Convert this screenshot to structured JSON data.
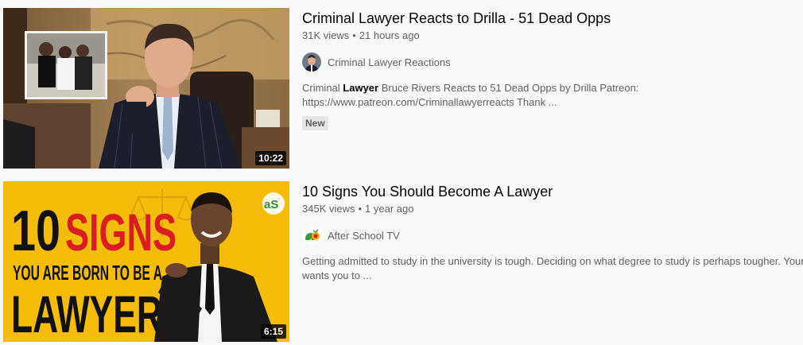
{
  "videos": [
    {
      "title": "Criminal Lawyer Reacts to Drilla - 51 Dead Opps",
      "views": "31K views",
      "age": "21 hours ago",
      "channel": "Criminal Lawyer Reactions",
      "desc_line1_pre": "Criminal ",
      "desc_line1_highlight": "Lawyer",
      "desc_line1_post": " Bruce Rivers Reacts to 51 Dead Opps by Drilla Patreon:",
      "desc_line2": "https://www.patreon.com/Criminallawyerreacts Thank ...",
      "badge": "New",
      "duration": "10:22",
      "thumbnail_icon": "lawyer-at-desk-thumbnail",
      "avatar_icon": "lawyer-avatar-icon"
    },
    {
      "title": "10 Signs You Should Become A Lawyer",
      "views": "345K views",
      "age": "1 year ago",
      "channel": "After School TV",
      "desc_line1": "Getting admitted to study in the university is tough. Deciding on what degree to study is perhaps tougher. Your",
      "desc_line2": "wants you to ...",
      "duration": "6:15",
      "thumb_number": "10",
      "thumb_signs": "SIGNS",
      "thumb_subtitle": "YOU ARE BORN TO BE A",
      "thumb_word": "LAWYER",
      "thumb_logo": "aS",
      "thumbnail_icon": "ten-signs-lawyer-thumbnail",
      "avatar_icon": "after-school-tv-logo-icon"
    }
  ],
  "colors": {
    "background": "#f9f9f9",
    "title_text": "#030303",
    "meta_text": "#606060",
    "badge_bg": "#e5e5e5",
    "thumb2_yellow": "#f5b800",
    "thumb2_red": "#d81e1e"
  }
}
